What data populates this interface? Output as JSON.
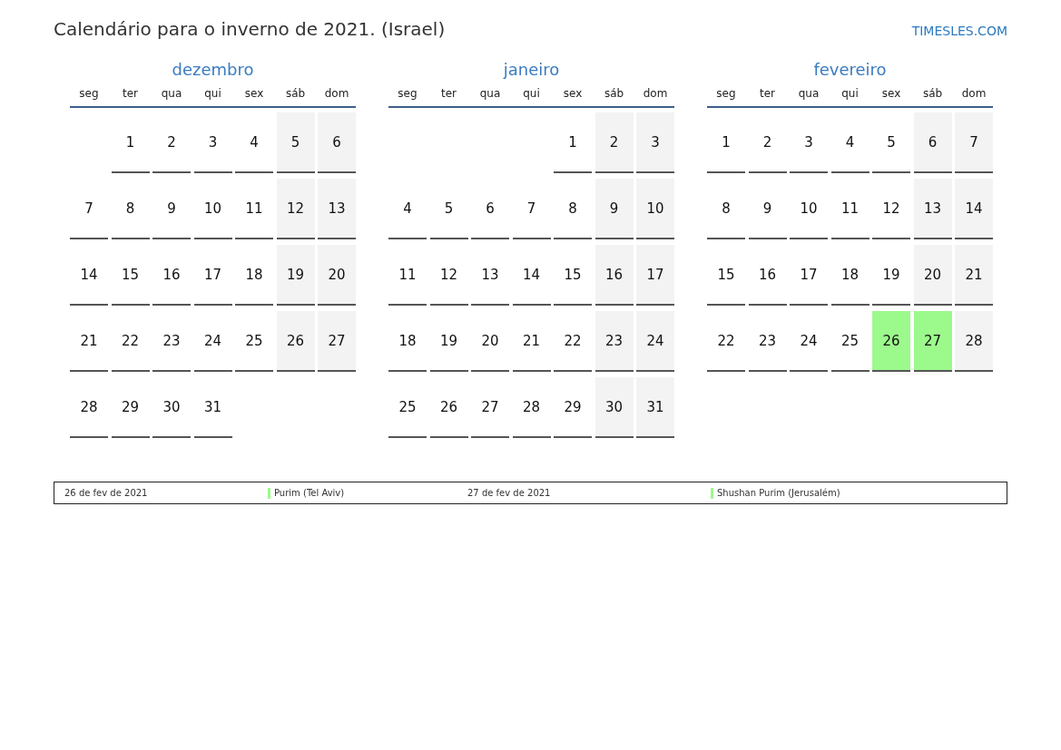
{
  "title": "Calendário para o inverno de 2021. (Israel)",
  "brand": "TIMESLES.COM",
  "months": [
    {
      "name": "dezembro",
      "weekdays": [
        "seg",
        "ter",
        "qua",
        "qui",
        "sex",
        "sáb",
        "dom"
      ],
      "weeks": [
        [
          {
            "kind": "blank"
          },
          {
            "day": "1",
            "kind": "weekday"
          },
          {
            "day": "2",
            "kind": "weekday"
          },
          {
            "day": "3",
            "kind": "weekday"
          },
          {
            "day": "4",
            "kind": "weekday"
          },
          {
            "day": "5",
            "kind": "weekend"
          },
          {
            "day": "6",
            "kind": "weekend"
          }
        ],
        [
          {
            "day": "7",
            "kind": "weekday"
          },
          {
            "day": "8",
            "kind": "weekday"
          },
          {
            "day": "9",
            "kind": "weekday"
          },
          {
            "day": "10",
            "kind": "weekday"
          },
          {
            "day": "11",
            "kind": "weekday"
          },
          {
            "day": "12",
            "kind": "weekend"
          },
          {
            "day": "13",
            "kind": "weekend"
          }
        ],
        [
          {
            "day": "14",
            "kind": "weekday"
          },
          {
            "day": "15",
            "kind": "weekday"
          },
          {
            "day": "16",
            "kind": "weekday"
          },
          {
            "day": "17",
            "kind": "weekday"
          },
          {
            "day": "18",
            "kind": "weekday"
          },
          {
            "day": "19",
            "kind": "weekend"
          },
          {
            "day": "20",
            "kind": "weekend"
          }
        ],
        [
          {
            "day": "21",
            "kind": "weekday"
          },
          {
            "day": "22",
            "kind": "weekday"
          },
          {
            "day": "23",
            "kind": "weekday"
          },
          {
            "day": "24",
            "kind": "weekday"
          },
          {
            "day": "25",
            "kind": "weekday"
          },
          {
            "day": "26",
            "kind": "weekend"
          },
          {
            "day": "27",
            "kind": "weekend"
          }
        ],
        [
          {
            "day": "28",
            "kind": "weekday"
          },
          {
            "day": "29",
            "kind": "weekday"
          },
          {
            "day": "30",
            "kind": "weekday"
          },
          {
            "day": "31",
            "kind": "weekday"
          }
        ]
      ]
    },
    {
      "name": "janeiro",
      "weekdays": [
        "seg",
        "ter",
        "qua",
        "qui",
        "sex",
        "sáb",
        "dom"
      ],
      "weeks": [
        [
          {
            "kind": "blank"
          },
          {
            "kind": "blank"
          },
          {
            "kind": "blank"
          },
          {
            "kind": "blank"
          },
          {
            "day": "1",
            "kind": "weekday"
          },
          {
            "day": "2",
            "kind": "weekend"
          },
          {
            "day": "3",
            "kind": "weekend"
          }
        ],
        [
          {
            "day": "4",
            "kind": "weekday"
          },
          {
            "day": "5",
            "kind": "weekday"
          },
          {
            "day": "6",
            "kind": "weekday"
          },
          {
            "day": "7",
            "kind": "weekday"
          },
          {
            "day": "8",
            "kind": "weekday"
          },
          {
            "day": "9",
            "kind": "weekend"
          },
          {
            "day": "10",
            "kind": "weekend"
          }
        ],
        [
          {
            "day": "11",
            "kind": "weekday"
          },
          {
            "day": "12",
            "kind": "weekday"
          },
          {
            "day": "13",
            "kind": "weekday"
          },
          {
            "day": "14",
            "kind": "weekday"
          },
          {
            "day": "15",
            "kind": "weekday"
          },
          {
            "day": "16",
            "kind": "weekend"
          },
          {
            "day": "17",
            "kind": "weekend"
          }
        ],
        [
          {
            "day": "18",
            "kind": "weekday"
          },
          {
            "day": "19",
            "kind": "weekday"
          },
          {
            "day": "20",
            "kind": "weekday"
          },
          {
            "day": "21",
            "kind": "weekday"
          },
          {
            "day": "22",
            "kind": "weekday"
          },
          {
            "day": "23",
            "kind": "weekend"
          },
          {
            "day": "24",
            "kind": "weekend"
          }
        ],
        [
          {
            "day": "25",
            "kind": "weekday"
          },
          {
            "day": "26",
            "kind": "weekday"
          },
          {
            "day": "27",
            "kind": "weekday"
          },
          {
            "day": "28",
            "kind": "weekday"
          },
          {
            "day": "29",
            "kind": "weekday"
          },
          {
            "day": "30",
            "kind": "weekend"
          },
          {
            "day": "31",
            "kind": "weekend"
          }
        ]
      ]
    },
    {
      "name": "fevereiro",
      "weekdays": [
        "seg",
        "ter",
        "qua",
        "qui",
        "sex",
        "sáb",
        "dom"
      ],
      "weeks": [
        [
          {
            "day": "1",
            "kind": "weekday"
          },
          {
            "day": "2",
            "kind": "weekday"
          },
          {
            "day": "3",
            "kind": "weekday"
          },
          {
            "day": "4",
            "kind": "weekday"
          },
          {
            "day": "5",
            "kind": "weekday"
          },
          {
            "day": "6",
            "kind": "weekend"
          },
          {
            "day": "7",
            "kind": "weekend"
          }
        ],
        [
          {
            "day": "8",
            "kind": "weekday"
          },
          {
            "day": "9",
            "kind": "weekday"
          },
          {
            "day": "10",
            "kind": "weekday"
          },
          {
            "day": "11",
            "kind": "weekday"
          },
          {
            "day": "12",
            "kind": "weekday"
          },
          {
            "day": "13",
            "kind": "weekend"
          },
          {
            "day": "14",
            "kind": "weekend"
          }
        ],
        [
          {
            "day": "15",
            "kind": "weekday"
          },
          {
            "day": "16",
            "kind": "weekday"
          },
          {
            "day": "17",
            "kind": "weekday"
          },
          {
            "day": "18",
            "kind": "weekday"
          },
          {
            "day": "19",
            "kind": "weekday"
          },
          {
            "day": "20",
            "kind": "weekend"
          },
          {
            "day": "21",
            "kind": "weekend"
          }
        ],
        [
          {
            "day": "22",
            "kind": "weekday"
          },
          {
            "day": "23",
            "kind": "weekday"
          },
          {
            "day": "24",
            "kind": "weekday"
          },
          {
            "day": "25",
            "kind": "weekday"
          },
          {
            "day": "26",
            "kind": "holiday",
            "color": "#9cf98c"
          },
          {
            "day": "27",
            "kind": "holiday",
            "color": "#9cf98c"
          },
          {
            "day": "28",
            "kind": "weekend"
          }
        ]
      ]
    }
  ],
  "holidays": [
    {
      "date": "26 de fev de 2021",
      "name": "Purim (Tel Aviv)",
      "color": "#9cf98c"
    },
    {
      "date": "27 de fev de 2021",
      "name": "Shushan Purim (Jerusalém)",
      "color": "#9cf98c"
    }
  ]
}
